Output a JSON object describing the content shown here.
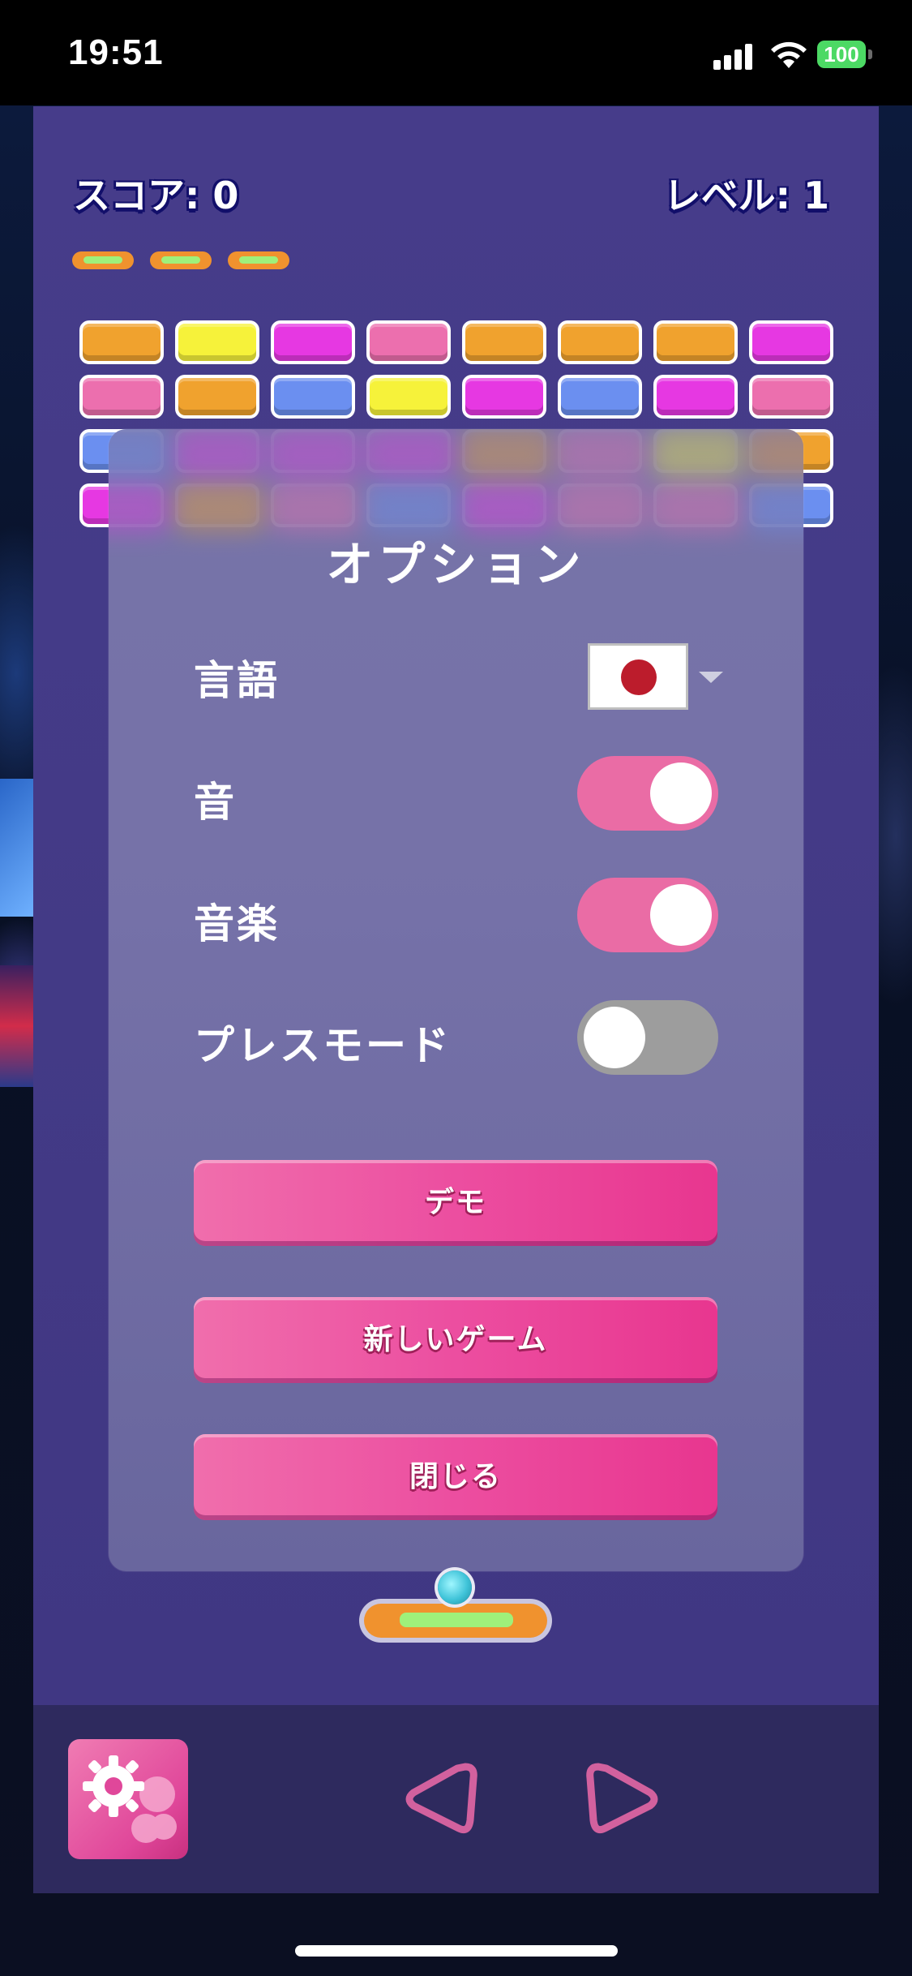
{
  "status_bar": {
    "time": "19:51",
    "battery": "100"
  },
  "hud": {
    "score": "スコア: 0",
    "level": "レベル: 1",
    "lives": 3
  },
  "bricks": {
    "rows": [
      [
        "orange",
        "yellow",
        "magenta",
        "pink",
        "orange",
        "orange",
        "orange",
        "magenta"
      ],
      [
        "pink",
        "orange",
        "blue",
        "yellow",
        "magenta",
        "blue",
        "magenta",
        "pink"
      ],
      [
        "blue",
        "magenta",
        "magenta",
        "magenta",
        "orange",
        "pink",
        "yellow",
        "orange"
      ],
      [
        "magenta",
        "orange",
        "pink",
        "blue",
        "magenta",
        "pink",
        "pink",
        "blue"
      ]
    ],
    "colors": {
      "orange": "#f0a22e",
      "yellow": "#f6f23a",
      "magenta": "#e638e2",
      "pink": "#ec6fae",
      "blue": "#6b8ff0"
    }
  },
  "options": {
    "title": "オプション",
    "language_label": "言語",
    "language_value": "Japanese flag",
    "sound_label": "音",
    "sound_on": true,
    "music_label": "音楽",
    "music_on": true,
    "press_mode_label": "プレスモード",
    "press_mode_on": false,
    "demo_button": "デモ",
    "new_game_button": "新しいゲーム",
    "close_button": "閉じる"
  },
  "controls": {
    "settings_icon": "gear-icon",
    "left_icon": "triangle-left-icon",
    "right_icon": "triangle-right-icon"
  },
  "theme": {
    "accent": "#e8368f",
    "background": "#433a86",
    "toggle_on": "#ea6ca5",
    "toggle_off": "#9d9d9d"
  }
}
